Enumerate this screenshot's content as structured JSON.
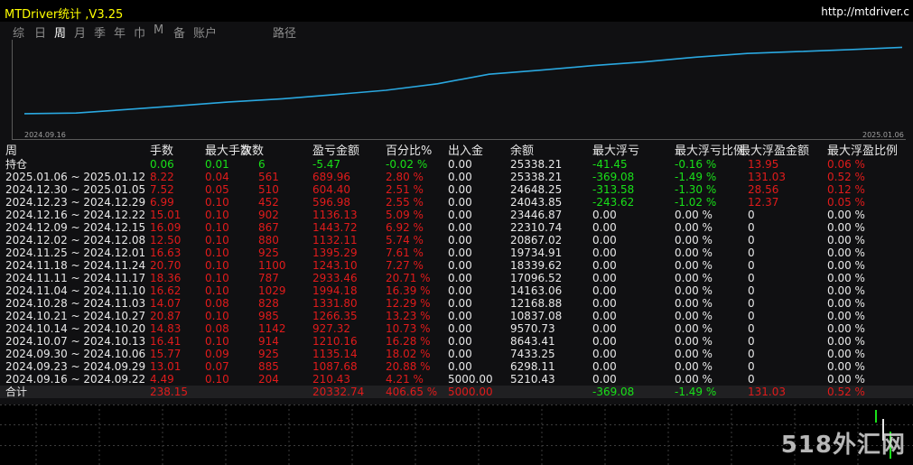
{
  "window": {
    "title": "MTDriver统计 ,V3.25",
    "url": "http://mtdriver.c"
  },
  "tabs": [
    {
      "label": "综",
      "active": false
    },
    {
      "label": "日",
      "active": false
    },
    {
      "label": "周",
      "active": true
    },
    {
      "label": "月",
      "active": false
    },
    {
      "label": "季",
      "active": false
    },
    {
      "label": "年",
      "active": false
    },
    {
      "label": "巾",
      "active": false
    },
    {
      "label": "M",
      "active": false
    },
    {
      "label": "备",
      "active": false
    },
    {
      "label": "账户",
      "active": false
    },
    {
      "label": "路径",
      "active": false
    }
  ],
  "chart": {
    "start_date": "2024.09.16",
    "end_date": "2025.01.06",
    "line_color": "#2aa8e0"
  },
  "table": {
    "headers": [
      "周",
      "手数",
      "最大手数",
      "次数",
      "盈亏金额",
      "百分比%",
      "出入金",
      "余额",
      "最大浮亏",
      "最大浮亏比例",
      "最大浮盈金额",
      "最大浮盈比例"
    ],
    "holding": {
      "label": "持仓",
      "lots": "0.06",
      "max_lots": "0.01",
      "count": "6",
      "pnl": "-5.47",
      "pct": "-0.02 %",
      "flow": "0.00",
      "balance": "25338.21",
      "max_float_loss": "-41.45",
      "max_float_loss_pct": "-0.16 %",
      "max_float_profit": "13.95",
      "max_float_profit_pct": "0.06 %"
    },
    "rows": [
      {
        "period": "2025.01.06 ~ 2025.01.12",
        "lots": "8.22",
        "max_lots": "0.04",
        "count": "561",
        "pnl": "689.96",
        "pct": "2.80 %",
        "flow": "0.00",
        "balance": "25338.21",
        "max_float_loss": "-369.08",
        "max_float_loss_pct": "-1.49 %",
        "max_float_profit": "131.03",
        "max_float_profit_pct": "0.52 %"
      },
      {
        "period": "2024.12.30 ~ 2025.01.05",
        "lots": "7.52",
        "max_lots": "0.05",
        "count": "510",
        "pnl": "604.40",
        "pct": "2.51 %",
        "flow": "0.00",
        "balance": "24648.25",
        "max_float_loss": "-313.58",
        "max_float_loss_pct": "-1.30 %",
        "max_float_profit": "28.56",
        "max_float_profit_pct": "0.12 %"
      },
      {
        "period": "2024.12.23 ~ 2024.12.29",
        "lots": "6.99",
        "max_lots": "0.10",
        "count": "452",
        "pnl": "596.98",
        "pct": "2.55 %",
        "flow": "0.00",
        "balance": "24043.85",
        "max_float_loss": "-243.62",
        "max_float_loss_pct": "-1.02 %",
        "max_float_profit": "12.37",
        "max_float_profit_pct": "0.05 %"
      },
      {
        "period": "2024.12.16 ~ 2024.12.22",
        "lots": "15.01",
        "max_lots": "0.10",
        "count": "902",
        "pnl": "1136.13",
        "pct": "5.09 %",
        "flow": "0.00",
        "balance": "23446.87",
        "max_float_loss": "0.00",
        "max_float_loss_pct": "0.00 %",
        "max_float_profit": "0",
        "max_float_profit_pct": "0.00 %"
      },
      {
        "period": "2024.12.09 ~ 2024.12.15",
        "lots": "16.09",
        "max_lots": "0.10",
        "count": "867",
        "pnl": "1443.72",
        "pct": "6.92 %",
        "flow": "0.00",
        "balance": "22310.74",
        "max_float_loss": "0.00",
        "max_float_loss_pct": "0.00 %",
        "max_float_profit": "0",
        "max_float_profit_pct": "0.00 %"
      },
      {
        "period": "2024.12.02 ~ 2024.12.08",
        "lots": "12.50",
        "max_lots": "0.10",
        "count": "880",
        "pnl": "1132.11",
        "pct": "5.74 %",
        "flow": "0.00",
        "balance": "20867.02",
        "max_float_loss": "0.00",
        "max_float_loss_pct": "0.00 %",
        "max_float_profit": "0",
        "max_float_profit_pct": "0.00 %"
      },
      {
        "period": "2024.11.25 ~ 2024.12.01",
        "lots": "16.63",
        "max_lots": "0.10",
        "count": "925",
        "pnl": "1395.29",
        "pct": "7.61 %",
        "flow": "0.00",
        "balance": "19734.91",
        "max_float_loss": "0.00",
        "max_float_loss_pct": "0.00 %",
        "max_float_profit": "0",
        "max_float_profit_pct": "0.00 %"
      },
      {
        "period": "2024.11.18 ~ 2024.11.24",
        "lots": "20.70",
        "max_lots": "0.10",
        "count": "1100",
        "pnl": "1243.10",
        "pct": "7.27 %",
        "flow": "0.00",
        "balance": "18339.62",
        "max_float_loss": "0.00",
        "max_float_loss_pct": "0.00 %",
        "max_float_profit": "0",
        "max_float_profit_pct": "0.00 %"
      },
      {
        "period": "2024.11.11 ~ 2024.11.17",
        "lots": "18.36",
        "max_lots": "0.10",
        "count": "787",
        "pnl": "2933.46",
        "pct": "20.71 %",
        "flow": "0.00",
        "balance": "17096.52",
        "max_float_loss": "0.00",
        "max_float_loss_pct": "0.00 %",
        "max_float_profit": "0",
        "max_float_profit_pct": "0.00 %"
      },
      {
        "period": "2024.11.04 ~ 2024.11.10",
        "lots": "16.62",
        "max_lots": "0.10",
        "count": "1029",
        "pnl": "1994.18",
        "pct": "16.39 %",
        "flow": "0.00",
        "balance": "14163.06",
        "max_float_loss": "0.00",
        "max_float_loss_pct": "0.00 %",
        "max_float_profit": "0",
        "max_float_profit_pct": "0.00 %"
      },
      {
        "period": "2024.10.28 ~ 2024.11.03",
        "lots": "14.07",
        "max_lots": "0.08",
        "count": "828",
        "pnl": "1331.80",
        "pct": "12.29 %",
        "flow": "0.00",
        "balance": "12168.88",
        "max_float_loss": "0.00",
        "max_float_loss_pct": "0.00 %",
        "max_float_profit": "0",
        "max_float_profit_pct": "0.00 %"
      },
      {
        "period": "2024.10.21 ~ 2024.10.27",
        "lots": "20.87",
        "max_lots": "0.10",
        "count": "985",
        "pnl": "1266.35",
        "pct": "13.23 %",
        "flow": "0.00",
        "balance": "10837.08",
        "max_float_loss": "0.00",
        "max_float_loss_pct": "0.00 %",
        "max_float_profit": "0",
        "max_float_profit_pct": "0.00 %"
      },
      {
        "period": "2024.10.14 ~ 2024.10.20",
        "lots": "14.83",
        "max_lots": "0.08",
        "count": "1142",
        "pnl": "927.32",
        "pct": "10.73 %",
        "flow": "0.00",
        "balance": "9570.73",
        "max_float_loss": "0.00",
        "max_float_loss_pct": "0.00 %",
        "max_float_profit": "0",
        "max_float_profit_pct": "0.00 %"
      },
      {
        "period": "2024.10.07 ~ 2024.10.13",
        "lots": "16.41",
        "max_lots": "0.10",
        "count": "914",
        "pnl": "1210.16",
        "pct": "16.28 %",
        "flow": "0.00",
        "balance": "8643.41",
        "max_float_loss": "0.00",
        "max_float_loss_pct": "0.00 %",
        "max_float_profit": "0",
        "max_float_profit_pct": "0.00 %"
      },
      {
        "period": "2024.09.30 ~ 2024.10.06",
        "lots": "15.77",
        "max_lots": "0.09",
        "count": "925",
        "pnl": "1135.14",
        "pct": "18.02 %",
        "flow": "0.00",
        "balance": "7433.25",
        "max_float_loss": "0.00",
        "max_float_loss_pct": "0.00 %",
        "max_float_profit": "0",
        "max_float_profit_pct": "0.00 %"
      },
      {
        "period": "2024.09.23 ~ 2024.09.29",
        "lots": "13.01",
        "max_lots": "0.07",
        "count": "885",
        "pnl": "1087.68",
        "pct": "20.88 %",
        "flow": "0.00",
        "balance": "6298.11",
        "max_float_loss": "0.00",
        "max_float_loss_pct": "0.00 %",
        "max_float_profit": "0",
        "max_float_profit_pct": "0.00 %"
      },
      {
        "period": "2024.09.16 ~ 2024.09.22",
        "lots": "4.49",
        "max_lots": "0.10",
        "count": "204",
        "pnl": "210.43",
        "pct": "4.21 %",
        "flow": "5000.00",
        "balance": "5210.43",
        "max_float_loss": "0.00",
        "max_float_loss_pct": "0.00 %",
        "max_float_profit": "0",
        "max_float_profit_pct": "0.00 %"
      }
    ],
    "summary": {
      "label": "合计",
      "lots": "238.15",
      "max_lots": "",
      "count": "",
      "pnl": "20332.74",
      "pct": "406.65 %",
      "flow": "5000.00",
      "balance": "",
      "max_float_loss": "-369.08",
      "max_float_loss_pct": "-1.49 %",
      "max_float_profit": "131.03",
      "max_float_profit_pct": "0.52 %"
    }
  },
  "watermark": "518外汇网"
}
